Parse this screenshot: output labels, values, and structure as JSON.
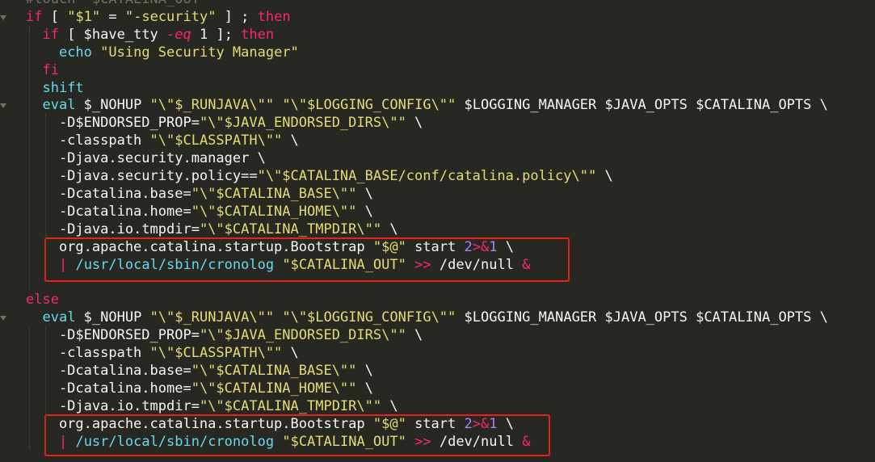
{
  "editor": {
    "lines": [
      [
        [
          "cmt",
          "#touch \"$CATALINA_OUT\""
        ]
      ],
      [
        [
          "kw",
          "if"
        ],
        [
          "plain",
          " [ "
        ],
        [
          "str",
          "\"$1\""
        ],
        [
          "plain",
          " = "
        ],
        [
          "str",
          "\"-security\""
        ],
        [
          "plain",
          " ] ; "
        ],
        [
          "kw",
          "then"
        ]
      ],
      [
        [
          "plain",
          "  "
        ],
        [
          "kw",
          "if"
        ],
        [
          "plain",
          " [ $have_tty "
        ],
        [
          "it",
          "-eq"
        ],
        [
          "plain",
          " 1 ]; "
        ],
        [
          "kw",
          "then"
        ]
      ],
      [
        [
          "plain",
          "    "
        ],
        [
          "fn",
          "echo"
        ],
        [
          "plain",
          " "
        ],
        [
          "str",
          "\"Using Security Manager\""
        ]
      ],
      [
        [
          "plain",
          "  "
        ],
        [
          "kw",
          "fi"
        ]
      ],
      [
        [
          "plain",
          "  "
        ],
        [
          "fn",
          "shift"
        ]
      ],
      [
        [
          "plain",
          "  "
        ],
        [
          "fn",
          "eval"
        ],
        [
          "plain",
          " $_NOHUP "
        ],
        [
          "str",
          "\"\\\"$_RUNJAVA\\\"\""
        ],
        [
          "plain",
          " "
        ],
        [
          "str",
          "\"\\\"$LOGGING_CONFIG\\\"\""
        ],
        [
          "plain",
          " $LOGGING_MANAGER $JAVA_OPTS $CATALINA_OPTS \\"
        ]
      ],
      [
        [
          "plain",
          "    -D$ENDORSED_PROP="
        ],
        [
          "str",
          "\"\\\"$JAVA_ENDORSED_DIRS\\\"\""
        ],
        [
          "plain",
          " \\"
        ]
      ],
      [
        [
          "plain",
          "    -classpath "
        ],
        [
          "str",
          "\"\\\"$CLASSPATH\\\"\""
        ],
        [
          "plain",
          " \\"
        ]
      ],
      [
        [
          "plain",
          "    -Djava.security.manager \\"
        ]
      ],
      [
        [
          "plain",
          "    -Djava.security.policy=="
        ],
        [
          "str",
          "\"\\\"$CATALINA_BASE/conf/catalina.policy\\\"\""
        ],
        [
          "plain",
          " \\"
        ]
      ],
      [
        [
          "plain",
          "    -Dcatalina.base="
        ],
        [
          "str",
          "\"\\\"$CATALINA_BASE\\\"\""
        ],
        [
          "plain",
          " \\"
        ]
      ],
      [
        [
          "plain",
          "    -Dcatalina.home="
        ],
        [
          "str",
          "\"\\\"$CATALINA_HOME\\\"\""
        ],
        [
          "plain",
          " \\"
        ]
      ],
      [
        [
          "plain",
          "    -Djava.io.tmpdir="
        ],
        [
          "str",
          "\"\\\"$CATALINA_TMPDIR\\\"\""
        ],
        [
          "plain",
          " \\"
        ]
      ],
      [
        [
          "plain",
          "    org.apache.catalina.startup.Bootstrap "
        ],
        [
          "str",
          "\"$@\""
        ],
        [
          "plain",
          " start "
        ],
        [
          "num",
          "2"
        ],
        [
          "op",
          ">&"
        ],
        [
          "num",
          "1"
        ],
        [
          "plain",
          " \\"
        ]
      ],
      [
        [
          "plain",
          "    "
        ],
        [
          "op",
          "|"
        ],
        [
          "plain",
          " "
        ],
        [
          "fn",
          "/usr/local/sbin/cronolog"
        ],
        [
          "plain",
          " "
        ],
        [
          "str",
          "\"$CATALINA_OUT\""
        ],
        [
          "plain",
          " "
        ],
        [
          "op",
          ">>"
        ],
        [
          "plain",
          " /dev/null "
        ],
        [
          "op",
          "&"
        ]
      ],
      [
        [
          "plain",
          ""
        ]
      ],
      [
        [
          "kw",
          "else"
        ]
      ],
      [
        [
          "plain",
          "  "
        ],
        [
          "fn",
          "eval"
        ],
        [
          "plain",
          " $_NOHUP "
        ],
        [
          "str",
          "\"\\\"$_RUNJAVA\\\"\""
        ],
        [
          "plain",
          " "
        ],
        [
          "str",
          "\"\\\"$LOGGING_CONFIG\\\"\""
        ],
        [
          "plain",
          " $LOGGING_MANAGER $JAVA_OPTS $CATALINA_OPTS \\"
        ]
      ],
      [
        [
          "plain",
          "    -D$ENDORSED_PROP="
        ],
        [
          "str",
          "\"\\\"$JAVA_ENDORSED_DIRS\\\"\""
        ],
        [
          "plain",
          " \\"
        ]
      ],
      [
        [
          "plain",
          "    -classpath "
        ],
        [
          "str",
          "\"\\\"$CLASSPATH\\\"\""
        ],
        [
          "plain",
          " \\"
        ]
      ],
      [
        [
          "plain",
          "    -Dcatalina.base="
        ],
        [
          "str",
          "\"\\\"$CATALINA_BASE\\\"\""
        ],
        [
          "plain",
          " \\"
        ]
      ],
      [
        [
          "plain",
          "    -Dcatalina.home="
        ],
        [
          "str",
          "\"\\\"$CATALINA_HOME\\\"\""
        ],
        [
          "plain",
          " \\"
        ]
      ],
      [
        [
          "plain",
          "    -Djava.io.tmpdir="
        ],
        [
          "str",
          "\"\\\"$CATALINA_TMPDIR\\\"\""
        ],
        [
          "plain",
          " \\"
        ]
      ],
      [
        [
          "plain",
          "    org.apache.catalina.startup.Bootstrap "
        ],
        [
          "str",
          "\"$@\""
        ],
        [
          "plain",
          " start "
        ],
        [
          "num",
          "2"
        ],
        [
          "op",
          ">&"
        ],
        [
          "num",
          "1"
        ],
        [
          "plain",
          " \\"
        ]
      ],
      [
        [
          "plain",
          "    "
        ],
        [
          "op",
          "|"
        ],
        [
          "plain",
          " "
        ],
        [
          "fn",
          "/usr/local/sbin/cronolog"
        ],
        [
          "plain",
          " "
        ],
        [
          "str",
          "\"$CATALINA_OUT\""
        ],
        [
          "plain",
          " "
        ],
        [
          "op",
          ">>"
        ],
        [
          "plain",
          " /dev/null "
        ],
        [
          "op",
          "&"
        ]
      ]
    ]
  },
  "colors": {
    "background": "#272822",
    "keyword": "#f92672",
    "string": "#e6db74",
    "function": "#66d9ef",
    "number": "#ae81ff",
    "text": "#f8f8f2",
    "highlight_box": "#e8201e"
  },
  "icons": [
    "fold-arrow-icon"
  ]
}
